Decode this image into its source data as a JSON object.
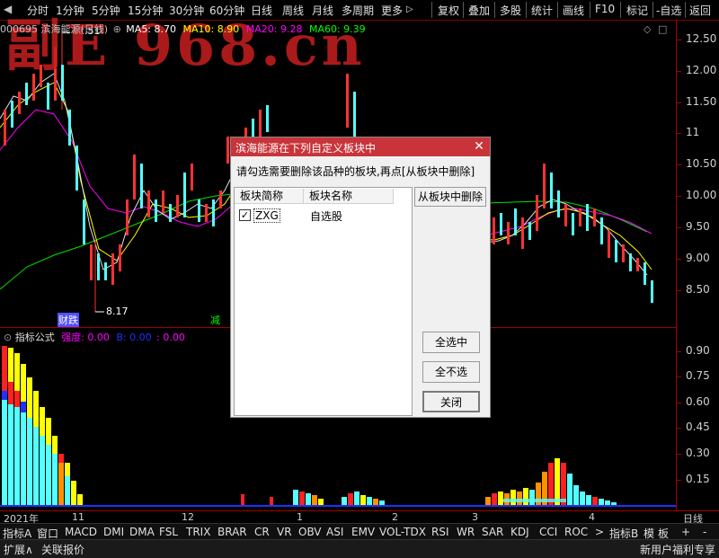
{
  "toolbar": {
    "periods": [
      "分时",
      "1分钟",
      "5分钟",
      "15分钟",
      "30分钟",
      "60分钟",
      "日线",
      "周线",
      "月线",
      "多周期",
      "更多"
    ],
    "more_arrow": "▷",
    "actions": [
      "复权",
      "叠加",
      "多股",
      "统计",
      "画线",
      "F10",
      "标记",
      "-自选",
      "返回"
    ]
  },
  "watermark": "副E 968.cn",
  "stock": {
    "code_name": "000695 滨海能源(日线)",
    "ma5_label": "MA5: 8.70",
    "ma10_label": "MA10: 8.90",
    "ma20_label": "MA20: 9.28",
    "ma60_label": "MA60: 9.39",
    "high_marker": "12.51",
    "low_marker": "8.17",
    "signal_left": "财跌",
    "signal_mid": "减"
  },
  "colors": {
    "ma5": "#ffffff",
    "ma10": "#ffff00",
    "ma20": "#ff00ff",
    "ma60": "#00ff00",
    "up": "#ff3232",
    "down": "#54ffff"
  },
  "price_axis": [
    "12.50",
    "12.00",
    "11.50",
    "11",
    "10.50",
    "10.00",
    "9.50",
    "9.00",
    "8.50"
  ],
  "indicator": {
    "name": "指标公式",
    "strength_label": "强度: 0.00",
    "b_label": "B: 0.00",
    "c_label": ": 0.00",
    "axis": [
      "0.90",
      "0.75",
      "0.60",
      "0.45",
      "0.30",
      "0.15"
    ]
  },
  "date_axis": {
    "labels": [
      "2021年",
      "11",
      "12",
      "1",
      "2",
      "3",
      "4"
    ],
    "period": "日线"
  },
  "tabs": [
    "指标A",
    "窗口",
    "MACD",
    "DMI",
    "DMA",
    "FSL",
    "TRIX",
    "BRAR",
    "CR",
    "VR",
    "OBV",
    "ASI",
    "EMV",
    "VOL-TDX",
    "RSI",
    "WR",
    "SAR",
    "KDJ",
    "CCI",
    "ROC",
    ">",
    "指标B",
    "模",
    "板"
  ],
  "tabs_right": [
    "+",
    "-"
  ],
  "status": {
    "left": [
      "扩展∧",
      "关联报价"
    ],
    "right": "新用户福利专享"
  },
  "dialog": {
    "title": "滨海能源在下列自定义板块中",
    "close": "✕",
    "message": "请勾选需要删除该品种的板块,再点[从板块中删除]",
    "col_short": "板块简称",
    "col_name": "板块名称",
    "rows": [
      {
        "short": "ZXG",
        "name": "自选股",
        "checked": true
      }
    ],
    "btn_remove": "从板块中删除",
    "btn_select_all": "全选中",
    "btn_select_none": "全不选",
    "btn_close": "关闭"
  }
}
